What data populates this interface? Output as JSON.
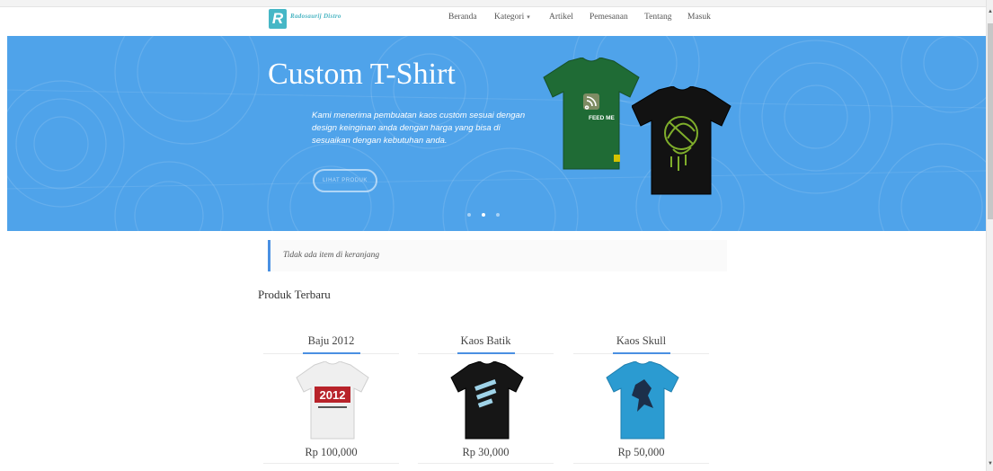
{
  "brand": {
    "logo_letter": "R",
    "name": "Radosaurij Distro"
  },
  "nav": [
    {
      "label": "Beranda"
    },
    {
      "label": "Kategori"
    },
    {
      "label": "Artikel"
    },
    {
      "label": "Pemesanan"
    },
    {
      "label": "Tentang"
    },
    {
      "label": "Masuk"
    }
  ],
  "nav_dropdown_caret": "▾",
  "hero": {
    "title": "Custom T-Shirt",
    "text": "Kami menerima pembuatan kaos custom sesuai dengan design keinginan anda dengan harga yang bisa di sesuaikan dengan kebutuhan anda.",
    "button_label": "LIHAT PRODUK",
    "shirt_print": "FEED ME",
    "slide_count": 3,
    "active_slide": 1,
    "background_color": "#4fa3ea"
  },
  "cart": {
    "message": "Tidak ada item di keranjang"
  },
  "section_title": "Produk Terbaru",
  "products": [
    {
      "name": "Baju 2012",
      "price": "Rp 100,000",
      "shirt_color": "#f2f2f2",
      "print_text": "2012"
    },
    {
      "name": "Kaos Batik",
      "price": "Rp 30,000",
      "shirt_color": "#1a1a1a"
    },
    {
      "name": "Kaos Skull",
      "price": "Rp 50,000",
      "shirt_color": "#2a9ad0"
    }
  ],
  "colors": {
    "accent": "#4a90e2",
    "logo": "#46b7c6"
  }
}
